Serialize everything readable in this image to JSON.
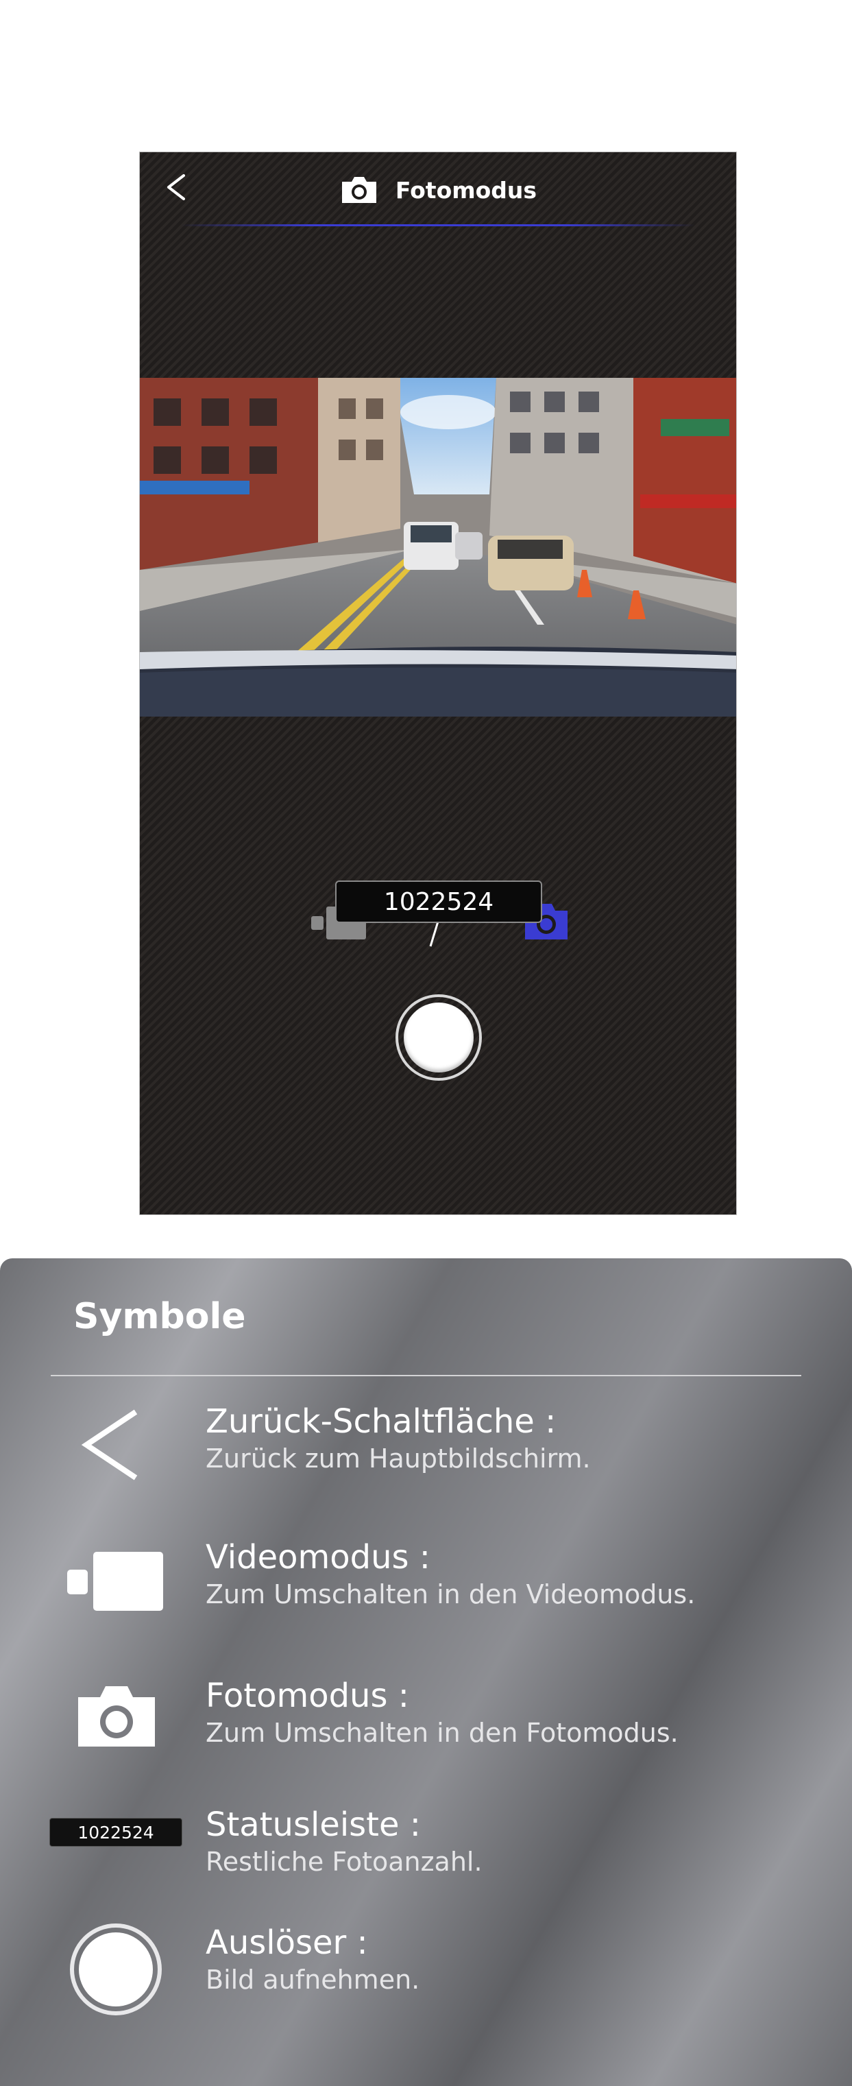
{
  "screen": {
    "title": "Fotomodus",
    "counter": "1022524",
    "colors": {
      "accent": "#3a3cd2",
      "background": "#2a2624"
    },
    "icons": {
      "back": "back-chevron-icon",
      "title": "camera-icon",
      "video_mode": "video-camera-icon",
      "photo_mode": "camera-icon",
      "shutter": "shutter-button"
    }
  },
  "legend": {
    "title": "Symbole",
    "items": [
      {
        "icon": "back-chevron-icon",
        "title": "Zurück-Schaltfläche :",
        "desc": "Zurück zum Hauptbildschirm."
      },
      {
        "icon": "video-camera-icon",
        "title": "Videomodus :",
        "desc": "Zum Umschalten in den Videomodus."
      },
      {
        "icon": "camera-icon",
        "title": "Fotomodus :",
        "desc": "Zum Umschalten in den Fotomodus."
      },
      {
        "icon": "status-bar-icon",
        "title": "Statusleiste :",
        "desc": "Restliche Fotoanzahl.",
        "sample": "1022524"
      },
      {
        "icon": "shutter-icon",
        "title": "Auslöser :",
        "desc": "Bild aufnehmen."
      }
    ]
  }
}
